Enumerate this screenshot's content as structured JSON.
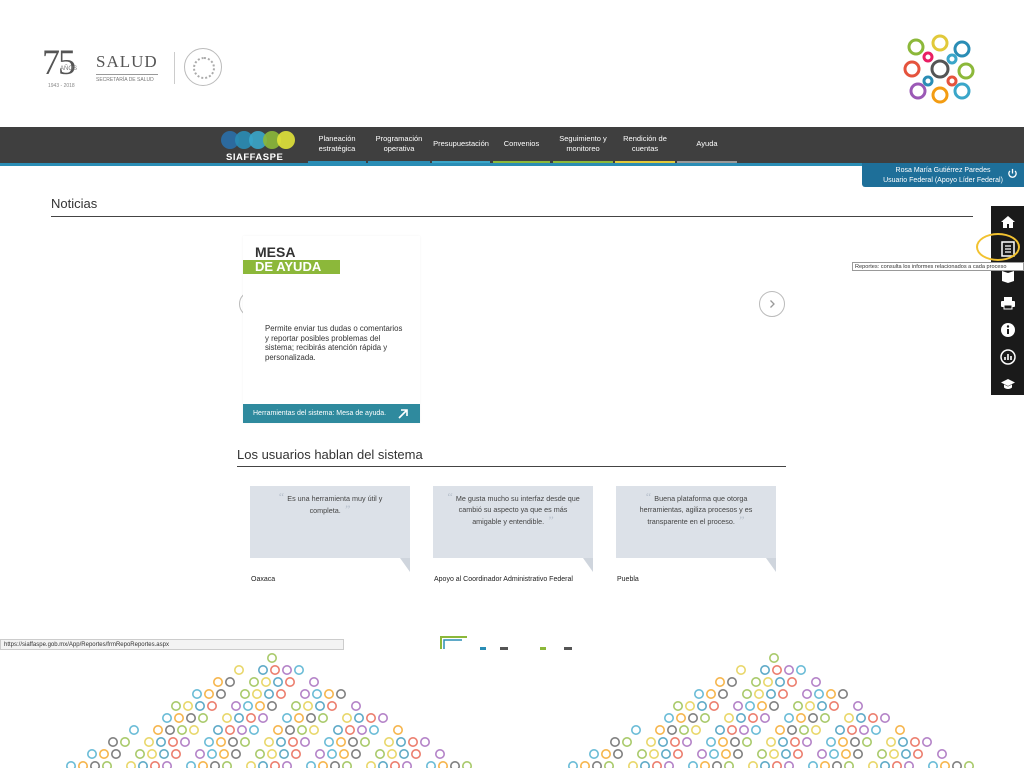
{
  "header": {
    "anniversary_number": "75",
    "anniversary_word": "AÑOS",
    "anniversary_years": "1943 - 2018",
    "salud_title": "SALUD",
    "salud_subtitle": "SECRETARÍA DE SALUD"
  },
  "navbar": {
    "brand": "SIAFFASPE",
    "items": [
      {
        "label": "Planeación estratégica",
        "color": "#2a8db5"
      },
      {
        "label": "Programación operativa",
        "color": "#2a8db5"
      },
      {
        "label": "Presupuestación",
        "color": "#3aa6c9"
      },
      {
        "label": "Convenios",
        "color": "#8cb83a"
      },
      {
        "label": "Seguimiento y monitoreo",
        "color": "#8cb83a"
      },
      {
        "label": "Rendición de cuentas",
        "color": "#e1c93a"
      },
      {
        "label": "Ayuda",
        "color": "#999999"
      }
    ]
  },
  "user": {
    "name": "Rosa María Gutiérrez Paredes",
    "role": "Usuario Federal (Apoyo Líder Federal)"
  },
  "news": {
    "title": "Noticias",
    "slide": {
      "heading_line1": "MESA",
      "heading_line2": "DE AYUDA",
      "description": "Permite enviar tus dudas o comentarios y reportar posibles problemas del sistema; recibirás atención rápida y personalizada.",
      "caption": "Herramientas del sistema: Mesa de ayuda."
    }
  },
  "testimonials": {
    "title": "Los usuarios hablan del sistema",
    "items": [
      {
        "quote": "Es una herramienta muy útil y completa.",
        "author": "Oaxaca"
      },
      {
        "quote": "Me gusta mucho su interfaz desde que cambió su aspecto ya que es más amigable y entendible.",
        "author": "Apoyo al Coordinador Administrativo Federal"
      },
      {
        "quote": "Buena plataforma que otorga herramientas, agiliza procesos y es transparente en el proceso.",
        "author": "Puebla"
      }
    ]
  },
  "status_bar": {
    "url": "https://siaffaspe.gob.mx/App/Reportes/frmRepoReportes.aspx"
  },
  "toolbar": {
    "icons": [
      "home-icon",
      "report-icon",
      "book-icon",
      "printer-icon",
      "info-icon",
      "chart-icon",
      "graduation-cap-icon"
    ],
    "tooltip": "Reportes: consulta los informes relacionados a cada proceso"
  },
  "colors": {
    "navbar_bg": "#3f3f3f",
    "accent_blue": "#2a8db5",
    "accent_green": "#8cb83a",
    "user_box": "#1e6f99",
    "caption_teal": "#2f8a9e",
    "highlight": "#f2c230"
  }
}
